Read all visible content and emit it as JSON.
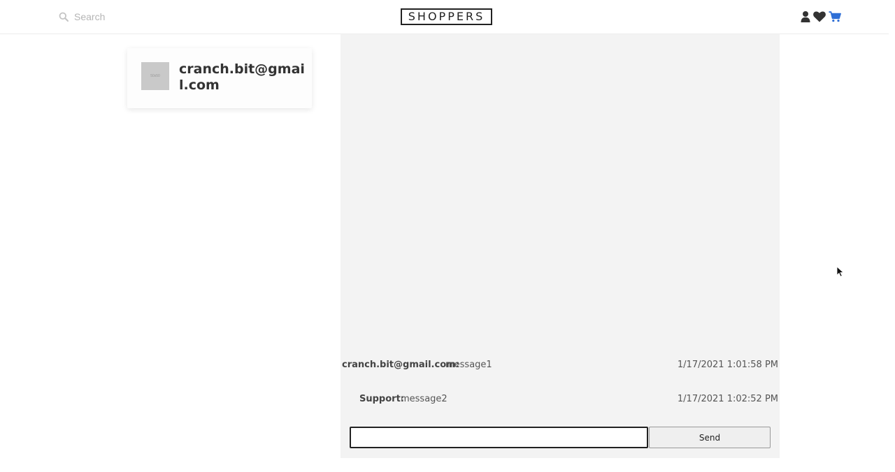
{
  "header": {
    "search": {
      "placeholder": "Search",
      "icon": "search-icon"
    },
    "logo": "SHOPPERS",
    "icons": [
      {
        "name": "user-icon"
      },
      {
        "name": "heart-icon"
      },
      {
        "name": "cart-icon"
      }
    ],
    "colors": {
      "cart": "#2f6fd6",
      "icons": "#333333"
    }
  },
  "contacts": [
    {
      "name": "cranch.bit@gmail.com",
      "avatar_text": "50x50"
    }
  ],
  "chat": {
    "messages": [
      {
        "sender": "cranch.bit@gmail.com:",
        "text": "message1",
        "time": "1/17/2021 1:01:58 PM"
      },
      {
        "sender": "Support:",
        "text": "message2",
        "time": "1/17/2021 1:02:52 PM"
      }
    ],
    "input": {
      "value": "",
      "placeholder": ""
    },
    "send_label": "Send"
  }
}
